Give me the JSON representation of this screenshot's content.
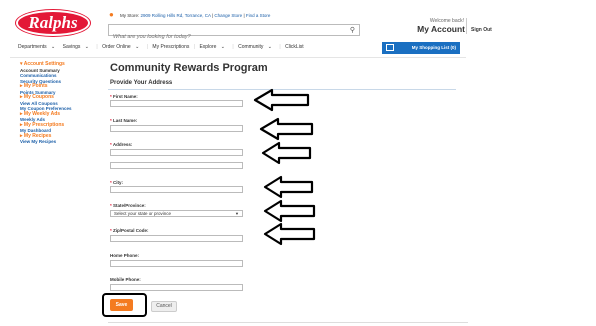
{
  "header": {
    "logo_text": "Ralphs",
    "store_label": "My Store:",
    "store_address": "2909 Rolling Hills Rd, Torrance, CA",
    "change_store": "Change Store",
    "find_store": "Find a Store",
    "search_placeholder": "What are you looking for today?",
    "welcome": "Welcome back!",
    "my_account": "My Account",
    "sign_out": "Sign Out"
  },
  "nav": {
    "items": [
      "Departments",
      "Savings",
      "Order Online",
      "My Prescriptions",
      "Explore",
      "Community",
      "ClickList"
    ],
    "shopping_list": "My Shopping List (0)"
  },
  "sidebar": {
    "groups": [
      {
        "heading": "Account Settings",
        "items": [
          "Account Summary",
          "Communications",
          "Security Questions"
        ]
      },
      {
        "heading": "My Points",
        "items": [
          "Points Summary"
        ]
      },
      {
        "heading": "My Coupons",
        "items": [
          "View All Coupons",
          "My Coupon Preferences"
        ]
      },
      {
        "heading": "My Weekly Ads",
        "items": [
          "Weekly Ads"
        ]
      },
      {
        "heading": "My Prescriptions",
        "items": [
          "My Dashboard"
        ]
      },
      {
        "heading": "My Recipes",
        "items": [
          "View My Recipes"
        ]
      }
    ]
  },
  "main": {
    "title": "Community Rewards Program",
    "subtitle": "Provide Your Address",
    "fields": {
      "first_name": "First Name:",
      "last_name": "Last Name:",
      "address": "Address:",
      "city": "City:",
      "state": "State/Province:",
      "state_placeholder": "Select your state or province",
      "zip": "Zip/Postal Code:",
      "home_phone": "Home Phone:",
      "mobile_phone": "Mobile Phone:"
    },
    "required_mark": "*",
    "save": "Save",
    "cancel": "Cancel"
  },
  "colors": {
    "brand_red": "#e31837",
    "accent_orange": "#f47b20",
    "link_blue": "#1a5ea8",
    "button_blue": "#1a6fc1"
  }
}
